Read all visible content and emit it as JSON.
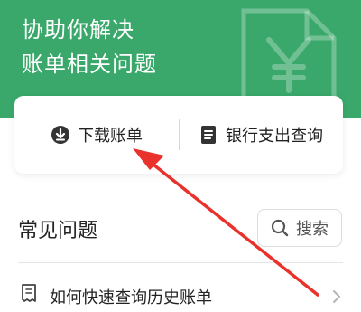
{
  "header": {
    "title_line1": "协助你解决",
    "title_line2": "账单相关问题",
    "watermark_icon": "yuan-document-icon",
    "accent_color": "#3aa86b"
  },
  "actions": {
    "download_label": "下载账单",
    "download_icon": "download-circle-icon",
    "bank_label": "银行支出查询",
    "bank_icon": "document-icon"
  },
  "faq": {
    "title": "常见问题",
    "search_label": "搜索",
    "search_icon": "search-icon",
    "items": [
      {
        "label": "如何快速查询历史账单",
        "icon": "receipt-icon"
      }
    ]
  },
  "annotation": {
    "arrow_color": "#e8322b",
    "arrow_icon": "red-arrow-annotation"
  }
}
